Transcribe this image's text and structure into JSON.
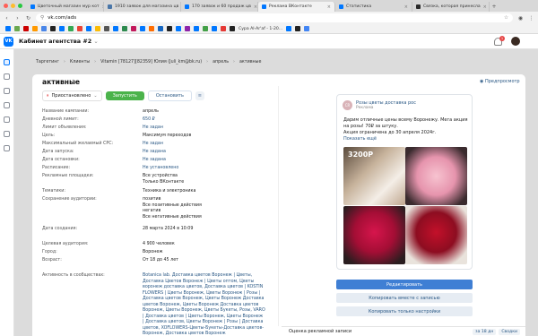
{
  "browser": {
    "tabs": [
      {
        "label": "Цветочный магазин мур кот",
        "color": "#0077ff"
      },
      {
        "label": "1910 заявок для магазина цв",
        "color": "#4a76a8"
      },
      {
        "label": "170 заявок и 60 продаж цв",
        "color": "#0077ff"
      },
      {
        "label": "Реклама ВКонтакте",
        "color": "#0077ff"
      },
      {
        "label": "Статистика",
        "color": "#0077ff"
      },
      {
        "label": "Связка, которая принесла",
        "color": "#2b2b2b"
      }
    ],
    "url": "vk.com/ads",
    "bookmark_text": "Сура Al-Ar'af - 1-20..."
  },
  "app": {
    "logo": "VK",
    "cabinet_title": "Кабинет агентства #2",
    "notification_count": "1"
  },
  "breadcrumbs": [
    "Таргетинг",
    "Клиенты",
    "Vitamin [78127][82359] Юлия (Juli_km@bk.ru)",
    "апрель",
    "активные"
  ],
  "page": {
    "title": "активные",
    "preview_label": "Предпросмотр",
    "status_label": "Приостановлено",
    "launch_label": "Запустить",
    "stop_label": "Остановить",
    "stats_label": "≡"
  },
  "properties": [
    {
      "label": "Название кампании:",
      "value": "апрель",
      "link": false
    },
    {
      "label": "Дневной лимит:",
      "value": "650 ₽",
      "link": true
    },
    {
      "label": "Лимит объявления:",
      "value": "Не задан",
      "link": true
    },
    {
      "label": "Цель:",
      "value": "Максимум переходов",
      "link": false
    },
    {
      "label": "Максимальный желаемый CPC:",
      "value": "Не задан",
      "link": true
    },
    {
      "label": "Дата запуска:",
      "value": "Не задана",
      "link": true
    },
    {
      "label": "Дата остановки:",
      "value": "Не задана",
      "link": true
    },
    {
      "label": "Расписание:",
      "value": "Не установлено",
      "link": true
    },
    {
      "label": "Рекламные площадки:",
      "value": "Все устройства\nТолько ВКонтакте",
      "link": false
    },
    {
      "label": "Тематики:",
      "value": "Техника и электроника",
      "link": false
    },
    {
      "label": "Сохранение аудитории:",
      "value": "позитив\n  Все позитивные действия\nнегатив\n  Все негативные действия",
      "link": false
    },
    {
      "label": "Дата создания:",
      "value": "28 марта 2024 в 10:09",
      "link": false
    },
    {
      "label": "Целевая аудитория:",
      "value": "4 900 человек",
      "link": false
    },
    {
      "label": "Город:",
      "value": "Воронеж",
      "link": false
    },
    {
      "label": "Возраст:",
      "value": "От 18 до 45 лет",
      "link": false
    },
    {
      "label": "Активность в сообществах:",
      "value": "Botanica lab. Доставка цветов Воронеж | Цветы, Доставка Цветов Воронеж | Цветы оптом, Цветы воронеж доставка цветов, Доставка цветов | KOSTIN FLOWERS | Цветы Воронеж, Цветы Воронеж | Розы | Доставка цветов Воронеж, Цветы Воронеж Доставка цветов Воронеж, Цветы Воронеж Доставка цветов Воронеж, Цветы Воронеж, Цветы Букеты, Розы, VARO | Доставка цветов | Цветы Воронеж, Цветы Воронеж | Доставка цветов, Цветы Воронеж | Розы | Доставка цветов, XOFLOWERS-Цветы-Букеты-Доставка цветов-Воронеж, Доставка цветов Воронеж",
      "link": true
    }
  ],
  "ad_card": {
    "avatar_text": "CR",
    "name": "Розы цветы доставка рос",
    "sublabel": "Реклама",
    "text": "Дарим отличные цены всему Воронежу. Мега акция на розы! 70₽ за штуку.\nАкция ограничена до 30 апреля 2024г.",
    "more_label": "Показать ещё",
    "price_overlay": "3200Р"
  },
  "actions": {
    "edit": "Редактировать",
    "copy_with_record": "Копировать вместе с записью",
    "copy_settings": "Копировать только настройки"
  },
  "bottom": {
    "label": "Оценка рекламной записи",
    "chips": [
      "за 18 дн",
      "Сводки"
    ]
  },
  "colors": {
    "accent": "#0077ff",
    "link": "#2a5885",
    "launch": "#4bb34b"
  }
}
